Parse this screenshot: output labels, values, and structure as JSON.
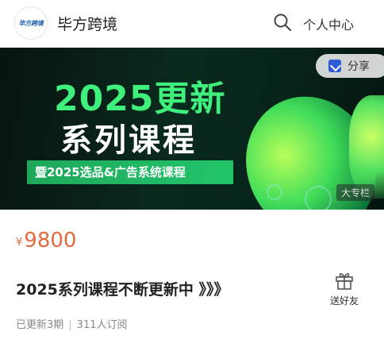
{
  "header": {
    "logo_text": "毕方跨境",
    "brand": "毕方跨境",
    "search_icon": "search-icon",
    "profile_label": "个人中心"
  },
  "banner": {
    "headline_year": "2025更新",
    "headline_series": "系列课程",
    "strip_text": "暨2025选品&广告系统课程",
    "share_label": "分享",
    "share_icon": "share-icon",
    "column_tag": "大专栏",
    "accent_color": "#3ff07c"
  },
  "course": {
    "currency": "¥",
    "price": "9800",
    "price_color": "#e06b3c",
    "title": "2025系列课程不断更新中 》》》",
    "gift_label": "送好友",
    "gift_icon": "gift-icon",
    "updated": "已更新3期",
    "subscribers": "311人订阅"
  }
}
